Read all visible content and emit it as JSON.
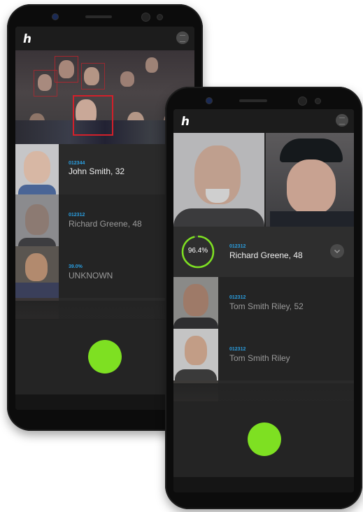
{
  "phone_left": {
    "logo": "h",
    "matches": [
      {
        "id": "012344",
        "name": "John Smith, 32",
        "dim": false
      },
      {
        "id": "012312",
        "name": "Richard Greene, 48",
        "dim": true
      },
      {
        "id": "39.0%",
        "name": "UNKNOWN",
        "dim": true
      }
    ]
  },
  "phone_right": {
    "logo": "h",
    "confidence": "96.4%",
    "confidence_value": 0.964,
    "selected": {
      "id": "012312",
      "name": "Richard Greene, 48"
    },
    "matches": [
      {
        "id": "012312",
        "name": "Tom Smith Riley, 52",
        "dim": true
      },
      {
        "id": "012312",
        "name": "Tom Smith Riley",
        "dim": true
      }
    ]
  },
  "colors": {
    "accent": "#7ee022",
    "id_text": "#2a9ee0",
    "screen_bg": "#242424",
    "detect_box": "#d3202a"
  }
}
